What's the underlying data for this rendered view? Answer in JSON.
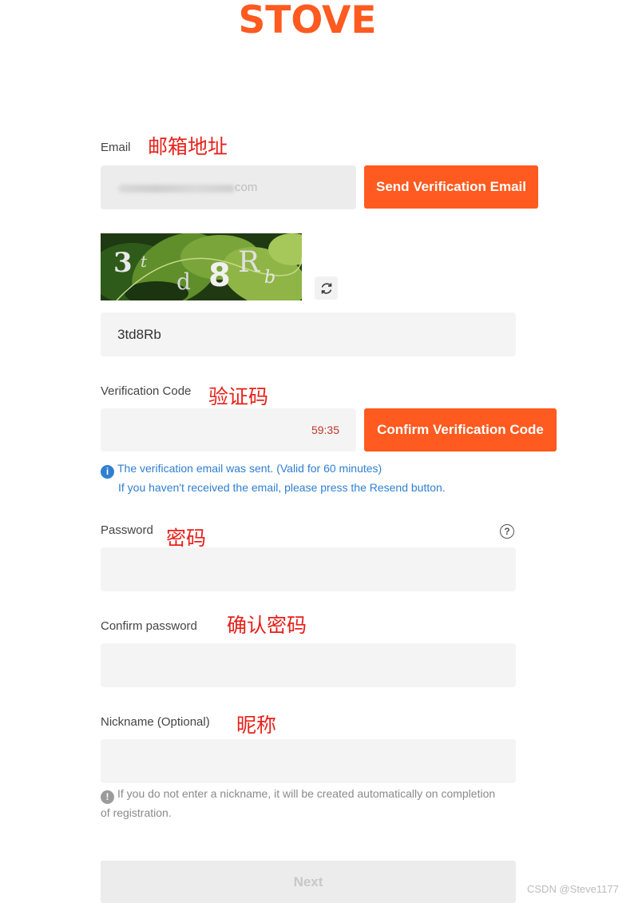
{
  "logo": {
    "text": "STOVE",
    "color": "#ff5a1f"
  },
  "email": {
    "label": "Email",
    "annotation": "邮箱地址",
    "value_suffix": "com",
    "send_button": "Send Verification Email"
  },
  "captcha": {
    "image_text": [
      "3",
      "t",
      "d",
      "8",
      "R",
      "b"
    ],
    "refresh_icon": "refresh-icon",
    "value": "3td8Rb"
  },
  "verification": {
    "label": "Verification Code",
    "annotation": "验证码",
    "timer": "59:35",
    "confirm_button": "Confirm Verification Code",
    "info_icon": "info-icon",
    "info_line1": "The verification email was sent. (Valid for 60 minutes)",
    "info_line2": "If you haven't received the email, please press the Resend button."
  },
  "password": {
    "label": "Password",
    "annotation": "密码",
    "help_icon": "question-circle-icon"
  },
  "confirm_password": {
    "label": "Confirm password",
    "annotation": "确认密码"
  },
  "nickname": {
    "label": "Nickname (Optional)",
    "annotation": "昵称",
    "note_line1": "If you do not enter a nickname, it will be created automatically on completion",
    "note_line2": "of registration."
  },
  "next_button": "Next",
  "watermark": "CSDN @Steve1177",
  "colors": {
    "accent": "#ff5a1f",
    "info": "#2f7fd1",
    "annotation": "#e8201a"
  }
}
